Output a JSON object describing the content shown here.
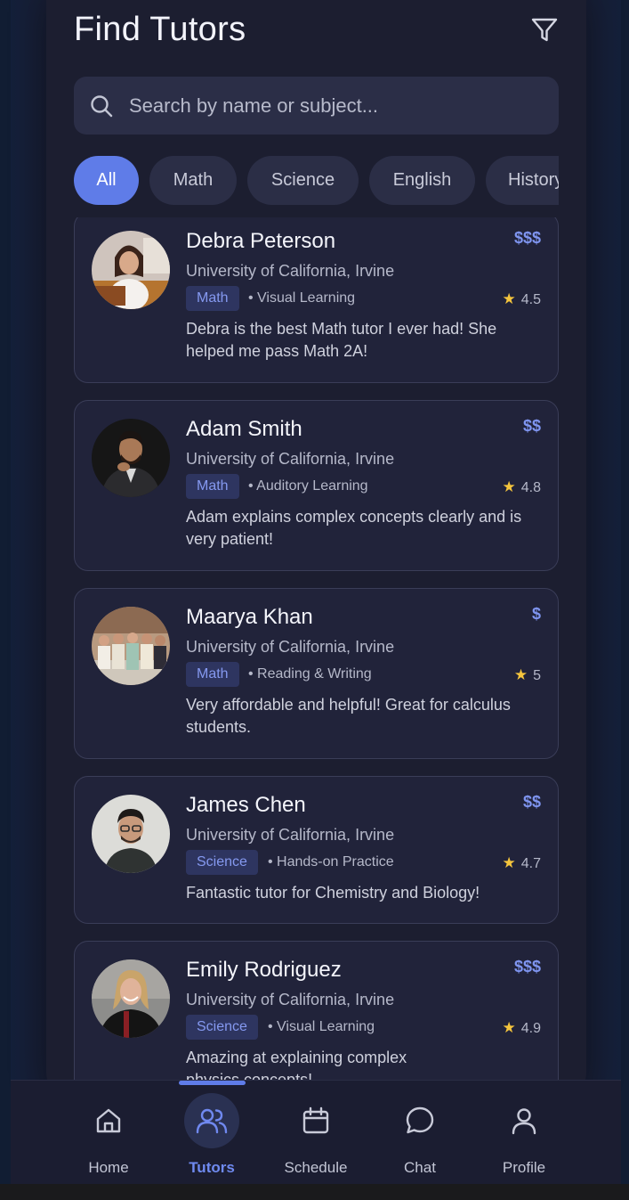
{
  "header": {
    "title": "Find Tutors"
  },
  "search": {
    "placeholder": "Search by name or subject..."
  },
  "filters": [
    "All",
    "Math",
    "Science",
    "English",
    "History"
  ],
  "tutors": [
    {
      "name": "Debra Peterson",
      "price": "$$$",
      "university": "University of California, Irvine",
      "subject": "Math",
      "style": "• Visual Learning",
      "rating": "4.5",
      "review": "Debra is the best Math tutor I ever had! She helped me pass Math 2A!"
    },
    {
      "name": "Adam Smith",
      "price": "$$",
      "university": "University of California, Irvine",
      "subject": "Math",
      "style": "• Auditory Learning",
      "rating": "4.8",
      "review": "Adam explains complex concepts clearly and is very patient!"
    },
    {
      "name": "Maarya Khan",
      "price": "$",
      "university": "University of California, Irvine",
      "subject": "Math",
      "style": "• Reading & Writing",
      "rating": "5",
      "review": "Very affordable and helpful! Great for calculus students."
    },
    {
      "name": "James Chen",
      "price": "$$",
      "university": "University of California, Irvine",
      "subject": "Science",
      "style": "• Hands-on Practice",
      "rating": "4.7",
      "review": "Fantastic tutor for Chemistry and Biology!"
    },
    {
      "name": "Emily Rodriguez",
      "price": "$$$",
      "university": "University of California, Irvine",
      "subject": "Science",
      "style": "• Visual Learning",
      "rating": "4.9",
      "review": "Amazing at explaining complex physics concepts!"
    }
  ],
  "nav": [
    {
      "label": "Home",
      "icon": "home-icon"
    },
    {
      "label": "Tutors",
      "icon": "users-icon",
      "active": true
    },
    {
      "label": "Schedule",
      "icon": "calendar-icon"
    },
    {
      "label": "Chat",
      "icon": "chat-bubble-icon"
    },
    {
      "label": "Profile",
      "icon": "user-icon"
    }
  ],
  "colors": {
    "accent": "#5f7ce8",
    "background": "#1c1e30",
    "card": "#21233a",
    "star": "#f5c53d"
  }
}
